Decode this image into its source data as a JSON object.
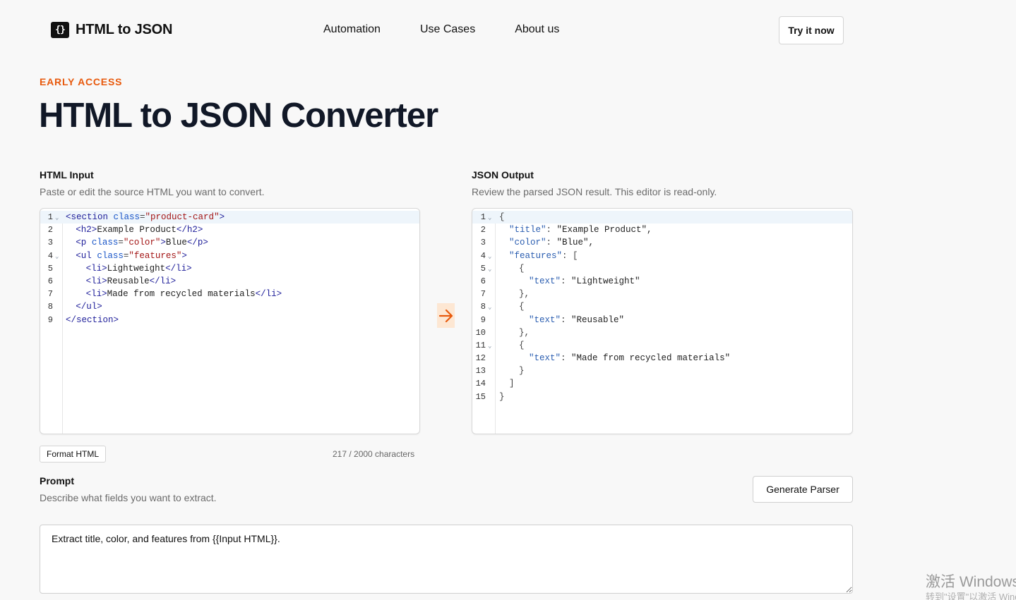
{
  "header": {
    "logo_glyph": "{}",
    "logo_text": "HTML to JSON",
    "nav": [
      "Automation",
      "Use Cases",
      "About us"
    ],
    "cta": "Try it now"
  },
  "hero": {
    "eyebrow": "EARLY ACCESS",
    "title": "HTML to JSON Converter"
  },
  "html_input": {
    "label": "HTML Input",
    "description": "Paste or edit the source HTML you want to convert.",
    "lines": [
      {
        "n": "1",
        "fold": true,
        "indent": 0,
        "tokens": [
          [
            "tag",
            "<section "
          ],
          [
            "attr",
            "class"
          ],
          [
            "punc",
            "="
          ],
          [
            "str",
            "\"product-card\""
          ],
          [
            "tag",
            ">"
          ]
        ]
      },
      {
        "n": "2",
        "fold": false,
        "indent": 1,
        "tokens": [
          [
            "tag",
            "<h2>"
          ],
          [
            "text",
            "Example Product"
          ],
          [
            "tag",
            "</h2>"
          ]
        ]
      },
      {
        "n": "3",
        "fold": false,
        "indent": 1,
        "tokens": [
          [
            "tag",
            "<p "
          ],
          [
            "attr",
            "class"
          ],
          [
            "punc",
            "="
          ],
          [
            "str",
            "\"color\""
          ],
          [
            "tag",
            ">"
          ],
          [
            "text",
            "Blue"
          ],
          [
            "tag",
            "</p>"
          ]
        ]
      },
      {
        "n": "4",
        "fold": true,
        "indent": 1,
        "tokens": [
          [
            "tag",
            "<ul "
          ],
          [
            "attr",
            "class"
          ],
          [
            "punc",
            "="
          ],
          [
            "str",
            "\"features\""
          ],
          [
            "tag",
            ">"
          ]
        ]
      },
      {
        "n": "5",
        "fold": false,
        "indent": 2,
        "tokens": [
          [
            "tag",
            "<li>"
          ],
          [
            "text",
            "Lightweight"
          ],
          [
            "tag",
            "</li>"
          ]
        ]
      },
      {
        "n": "6",
        "fold": false,
        "indent": 2,
        "tokens": [
          [
            "tag",
            "<li>"
          ],
          [
            "text",
            "Reusable"
          ],
          [
            "tag",
            "</li>"
          ]
        ]
      },
      {
        "n": "7",
        "fold": false,
        "indent": 2,
        "tokens": [
          [
            "tag",
            "<li>"
          ],
          [
            "text",
            "Made from recycled materials"
          ],
          [
            "tag",
            "</li>"
          ]
        ]
      },
      {
        "n": "8",
        "fold": false,
        "indent": 1,
        "tokens": [
          [
            "tag",
            "</ul>"
          ]
        ]
      },
      {
        "n": "9",
        "fold": false,
        "indent": 0,
        "tokens": [
          [
            "tag",
            "</section>"
          ]
        ]
      }
    ],
    "format_button": "Format HTML",
    "char_count": "217 / 2000 characters"
  },
  "json_output": {
    "label": "JSON Output",
    "description": "Review the parsed JSON result. This editor is read-only.",
    "lines": [
      {
        "n": "1",
        "fold": true,
        "indent": 0,
        "tokens": [
          [
            "punc",
            "{"
          ]
        ]
      },
      {
        "n": "2",
        "fold": false,
        "indent": 1,
        "tokens": [
          [
            "key",
            "\"title\""
          ],
          [
            "punc",
            ": "
          ],
          [
            "text",
            "\"Example Product\","
          ]
        ]
      },
      {
        "n": "3",
        "fold": false,
        "indent": 1,
        "tokens": [
          [
            "key",
            "\"color\""
          ],
          [
            "punc",
            ": "
          ],
          [
            "text",
            "\"Blue\","
          ]
        ]
      },
      {
        "n": "4",
        "fold": true,
        "indent": 1,
        "tokens": [
          [
            "key",
            "\"features\""
          ],
          [
            "punc",
            ": ["
          ]
        ]
      },
      {
        "n": "5",
        "fold": true,
        "indent": 2,
        "tokens": [
          [
            "punc",
            "{"
          ]
        ]
      },
      {
        "n": "6",
        "fold": false,
        "indent": 3,
        "tokens": [
          [
            "key",
            "\"text\""
          ],
          [
            "punc",
            ": "
          ],
          [
            "text",
            "\"Lightweight\""
          ]
        ]
      },
      {
        "n": "7",
        "fold": false,
        "indent": 2,
        "tokens": [
          [
            "punc",
            "},"
          ]
        ]
      },
      {
        "n": "8",
        "fold": true,
        "indent": 2,
        "tokens": [
          [
            "punc",
            "{"
          ]
        ]
      },
      {
        "n": "9",
        "fold": false,
        "indent": 3,
        "tokens": [
          [
            "key",
            "\"text\""
          ],
          [
            "punc",
            ": "
          ],
          [
            "text",
            "\"Reusable\""
          ]
        ]
      },
      {
        "n": "10",
        "fold": false,
        "indent": 2,
        "tokens": [
          [
            "punc",
            "},"
          ]
        ]
      },
      {
        "n": "11",
        "fold": true,
        "indent": 2,
        "tokens": [
          [
            "punc",
            "{"
          ]
        ]
      },
      {
        "n": "12",
        "fold": false,
        "indent": 3,
        "tokens": [
          [
            "key",
            "\"text\""
          ],
          [
            "punc",
            ": "
          ],
          [
            "text",
            "\"Made from recycled materials\""
          ]
        ]
      },
      {
        "n": "13",
        "fold": false,
        "indent": 2,
        "tokens": [
          [
            "punc",
            "}"
          ]
        ]
      },
      {
        "n": "14",
        "fold": false,
        "indent": 1,
        "tokens": [
          [
            "punc",
            "]"
          ]
        ]
      },
      {
        "n": "15",
        "fold": false,
        "indent": 0,
        "tokens": [
          [
            "punc",
            "}"
          ]
        ]
      }
    ]
  },
  "prompt": {
    "label": "Prompt",
    "description": "Describe what fields you want to extract.",
    "value": "Extract title, color, and features from {{Input HTML}}.",
    "generate_button": "Generate Parser"
  },
  "watermark": {
    "title": "激活 Windows",
    "subtitle": "转到\"设置\"以激活 Windows。"
  },
  "colors": {
    "accent": "#e8590c",
    "arrow_bg": "#fde7d3",
    "active_line": "#eef5fb"
  },
  "icons": {
    "logo": "braces-logo-icon",
    "arrow": "arrow-right-icon",
    "fold": "chevron-down-icon"
  }
}
